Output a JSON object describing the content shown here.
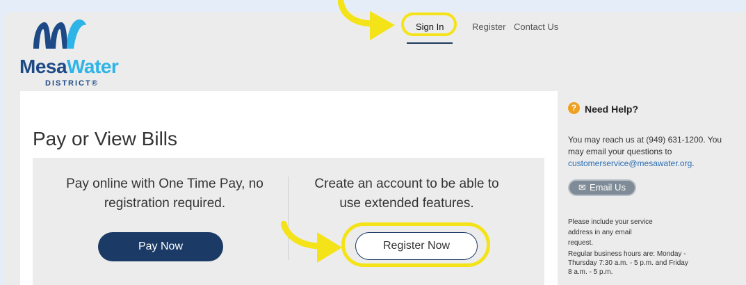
{
  "logo": {
    "brand_mesa": "Mesa",
    "brand_water": "Water",
    "district": "DISTRICT®"
  },
  "nav": {
    "sign_in": "Sign In",
    "register": "Register",
    "contact": "Contact Us"
  },
  "main": {
    "title": "Pay or View Bills",
    "pay_text": "Pay online with One Time Pay, no registration required.",
    "pay_button": "Pay Now",
    "register_text": "Create an account to be able to use extended features.",
    "register_button": "Register Now"
  },
  "help": {
    "title": "Need Help?",
    "icon": "question-icon",
    "line1": "You may reach us at (949) 631-1200. You may email your questions to",
    "email": "customerservice@mesawater.org",
    "line1_end": ".",
    "email_button": "Email Us",
    "note": "Please include your service address in any email request.",
    "hours": "Regular business hours are: Monday - Thursday 7:30 a.m. - 5 p.m. and Friday 8 a.m. - 5 p.m."
  },
  "colors": {
    "brand_navy": "#1b3a66",
    "brand_cyan": "#2eb4e6",
    "highlight_yellow": "#f4e318",
    "link_blue": "#2a6db3",
    "help_orange": "#f0a020"
  }
}
